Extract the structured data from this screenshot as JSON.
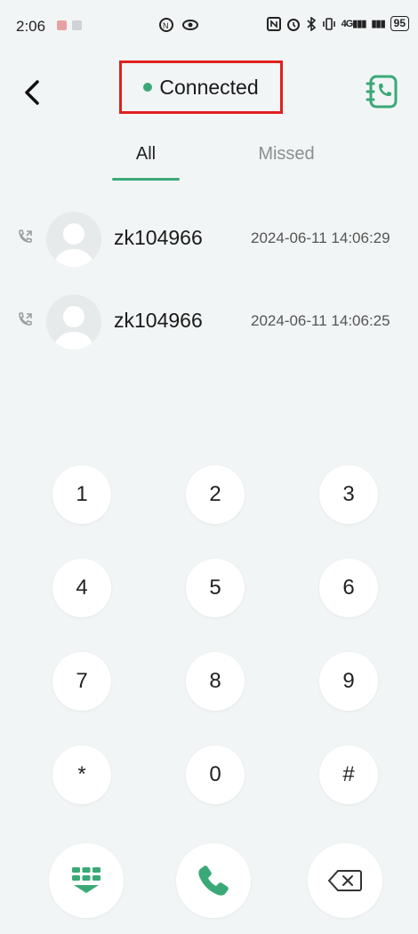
{
  "status_bar": {
    "time": "2:06",
    "network_label": "4G",
    "battery": "95"
  },
  "header": {
    "connection_status": "Connected",
    "status_color": "#3aa977"
  },
  "tabs": [
    {
      "label": "All",
      "active": true
    },
    {
      "label": "Missed",
      "active": false
    }
  ],
  "call_log": [
    {
      "name": "zk104966",
      "datetime": "2024-06-11 14:06:29"
    },
    {
      "name": "zk104966",
      "datetime": "2024-06-11 14:06:25"
    }
  ],
  "keypad": {
    "keys": [
      "1",
      "2",
      "3",
      "4",
      "5",
      "6",
      "7",
      "8",
      "9",
      "*",
      "0",
      "#"
    ]
  },
  "actions": {
    "keypad_toggle_icon": "dialpad-icon",
    "call_icon": "phone-icon",
    "delete_icon": "backspace-icon"
  },
  "colors": {
    "accent": "#3aa977",
    "highlight_box": "#e02020",
    "background": "#f2f5f5"
  }
}
